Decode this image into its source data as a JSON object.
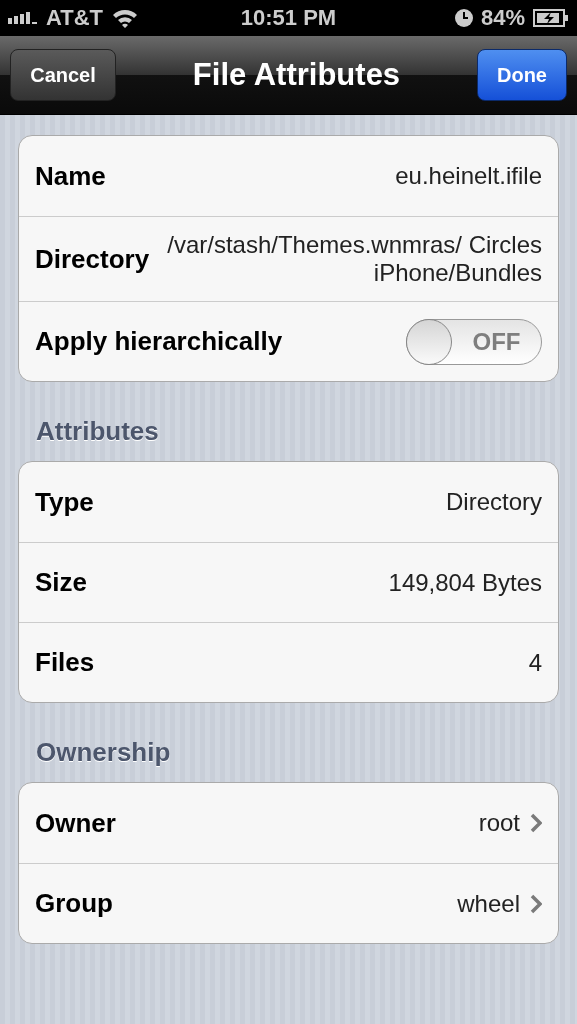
{
  "status_bar": {
    "carrier": "AT&T",
    "time": "10:51 PM",
    "battery": "84%"
  },
  "nav_bar": {
    "title": "File Attributes",
    "left_button": "Cancel",
    "right_button": "Done"
  },
  "sections": [
    {
      "rows": [
        {
          "kind": "value",
          "label": "Name",
          "value": "eu.heinelt.ifile"
        },
        {
          "kind": "value",
          "label": "Directory",
          "value": "/var/stash/Themes.wnmras/ Circles iPhone/Bundles"
        },
        {
          "kind": "toggle",
          "label": "Apply hierarchically",
          "on": false,
          "state_text": "OFF"
        }
      ]
    },
    {
      "header": "Attributes",
      "rows": [
        {
          "kind": "value",
          "label": "Type",
          "value": "Directory"
        },
        {
          "kind": "value",
          "label": "Size",
          "value": "149,804 Bytes"
        },
        {
          "kind": "value",
          "label": "Files",
          "value": "4"
        }
      ]
    },
    {
      "header": "Ownership",
      "rows": [
        {
          "kind": "link",
          "label": "Owner",
          "value": "root"
        },
        {
          "kind": "link",
          "label": "Group",
          "value": "wheel"
        }
      ]
    }
  ]
}
